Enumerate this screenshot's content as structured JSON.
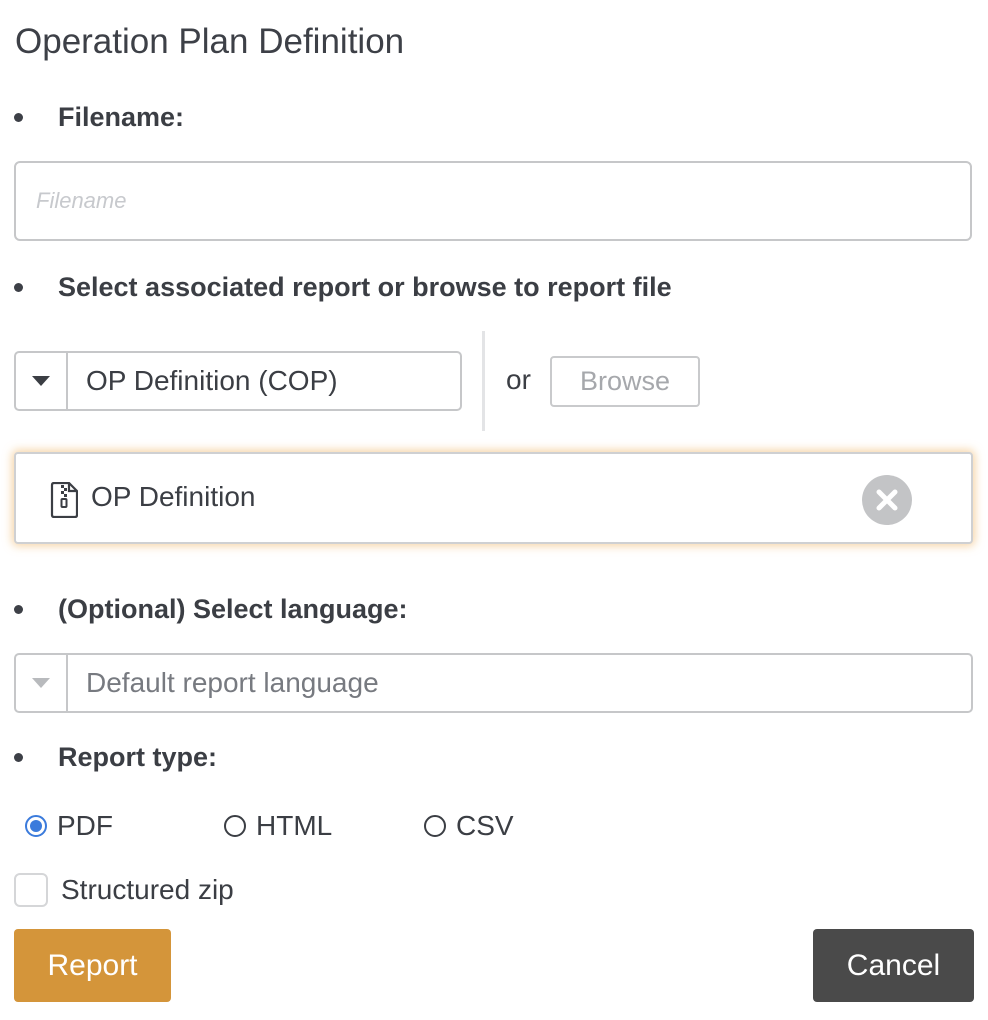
{
  "dialog": {
    "title": "Operation Plan Definition"
  },
  "filename": {
    "label": "Filename:",
    "placeholder": "Filename",
    "value": ""
  },
  "report_select": {
    "label": "Select associated report or browse to report file",
    "selected": "OP Definition (COP)",
    "or_text": "or",
    "browse_label": "Browse",
    "caret_icon": "caret-down-icon"
  },
  "selected_file": {
    "name": "OP Definition",
    "icon": "zip-file-icon",
    "remove_icon": "close-icon"
  },
  "language": {
    "label": "(Optional) Select language:",
    "selected": "Default report language"
  },
  "report_type": {
    "label": "Report type:",
    "options": [
      {
        "label": "PDF",
        "checked": true
      },
      {
        "label": "HTML",
        "checked": false
      },
      {
        "label": "CSV",
        "checked": false
      }
    ]
  },
  "structured_zip": {
    "label": "Structured zip",
    "checked": false
  },
  "actions": {
    "report_label": "Report",
    "cancel_label": "Cancel"
  },
  "colors": {
    "report_button": "#d4953a",
    "cancel_button": "#4a4a4a",
    "radio_checked": "#3b7bdc",
    "card_glow": "#eeb05c"
  }
}
